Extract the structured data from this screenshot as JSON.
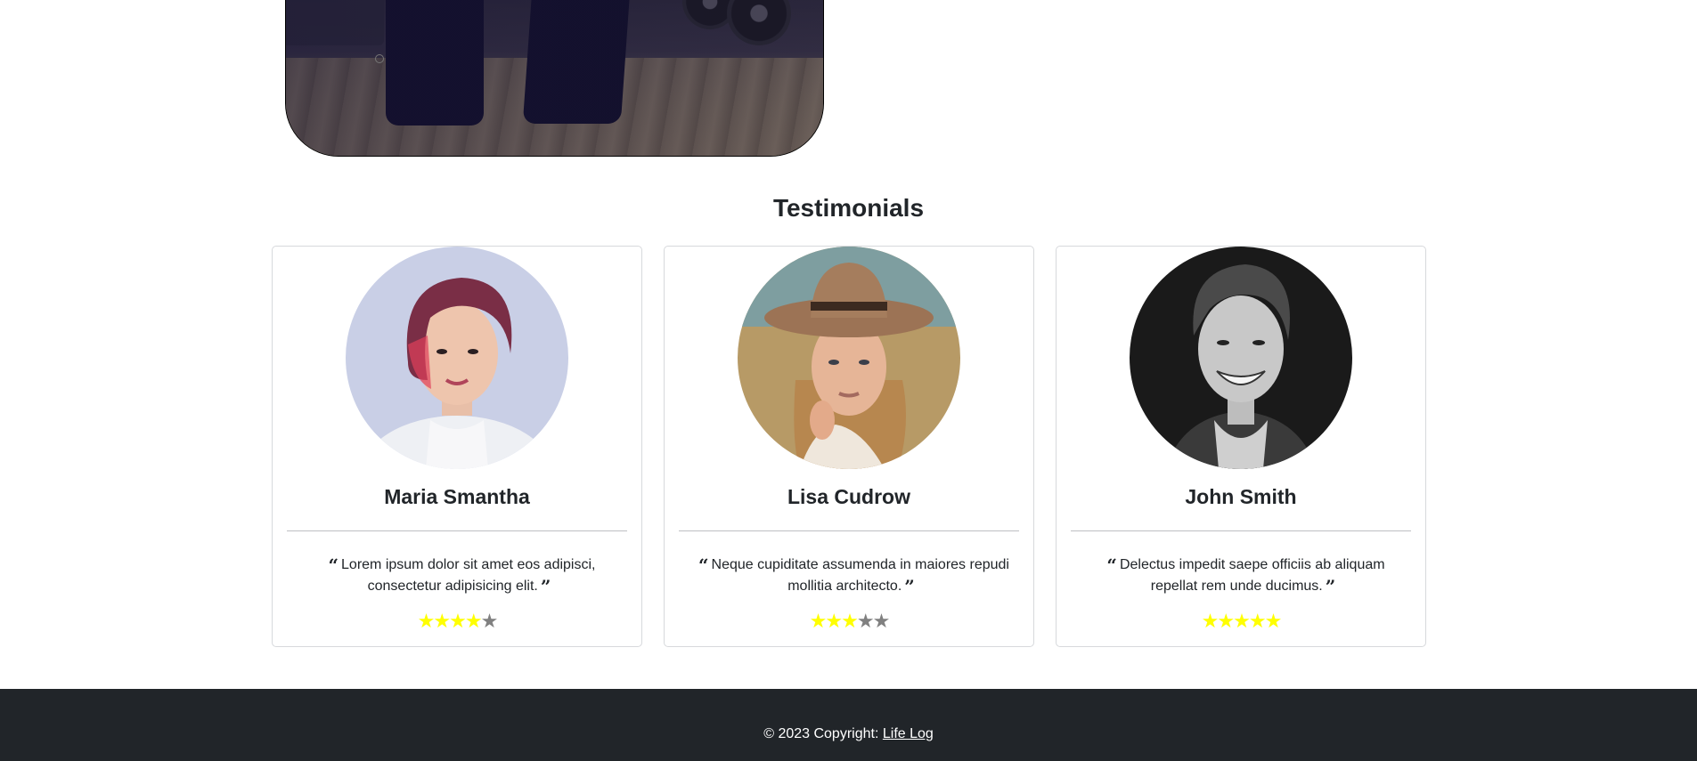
{
  "hero": {
    "image_alt": "person standing in gym"
  },
  "testimonials": {
    "title": "Testimonials",
    "items": [
      {
        "name": "Maria Smantha",
        "quote": "Lorem ipsum dolor sit amet eos adipisci, consectetur adipisicing elit.",
        "rating": 4,
        "max_rating": 5,
        "avatar_icon": "woman-portrait-avatar"
      },
      {
        "name": "Lisa Cudrow",
        "quote": "Neque cupiditate assumenda in maiores repudi mollitia architecto.",
        "rating": 3,
        "max_rating": 5,
        "avatar_icon": "woman-hat-portrait-avatar"
      },
      {
        "name": "John Smith",
        "quote": "Delectus impedit saepe officiis ab aliquam repellat rem unde ducimus.",
        "rating": 5,
        "max_rating": 5,
        "avatar_icon": "man-portrait-avatar"
      }
    ]
  },
  "footer": {
    "copyright": "© 2023 Copyright:",
    "link_text": "Life Log"
  },
  "colors": {
    "star_on": "#ffff00",
    "star_off": "#808080",
    "footer_bg": "#212529"
  }
}
